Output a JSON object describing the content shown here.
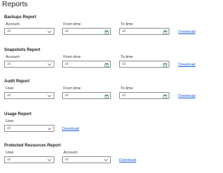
{
  "page": {
    "title": "Reports"
  },
  "download_label": "Download",
  "sections": [
    {
      "title": "Backups Report",
      "fields": [
        {
          "label": "Account",
          "value": "all",
          "kind": "select"
        },
        {
          "label": "From time",
          "value": "all",
          "kind": "date"
        },
        {
          "label": "To time",
          "value": "all",
          "kind": "date"
        }
      ]
    },
    {
      "title": "Snapshots Report",
      "fields": [
        {
          "label": "Account",
          "value": "all",
          "kind": "select"
        },
        {
          "label": "From time",
          "value": "all",
          "kind": "date"
        },
        {
          "label": "To time",
          "value": "all",
          "kind": "date"
        }
      ]
    },
    {
      "title": "Audit Report",
      "fields": [
        {
          "label": "User",
          "value": "all",
          "kind": "select"
        },
        {
          "label": "From time",
          "value": "all",
          "kind": "date"
        },
        {
          "label": "To time",
          "value": "all",
          "kind": "date"
        }
      ]
    },
    {
      "title": "Usage Report",
      "fields": [
        {
          "label": "User",
          "value": "all",
          "kind": "select"
        }
      ]
    },
    {
      "title": "Protected Resources Report",
      "fields": [
        {
          "label": "User",
          "value": "all",
          "kind": "select"
        },
        {
          "label": "Account",
          "value": "all",
          "kind": "select"
        }
      ]
    }
  ],
  "icons": {
    "select": "chevron-down-icon",
    "date": "calendar-icon"
  },
  "colors": {
    "link": "#1a5ad9",
    "calendar_icon": "#3b8a52",
    "border": "#8c8c8c"
  }
}
